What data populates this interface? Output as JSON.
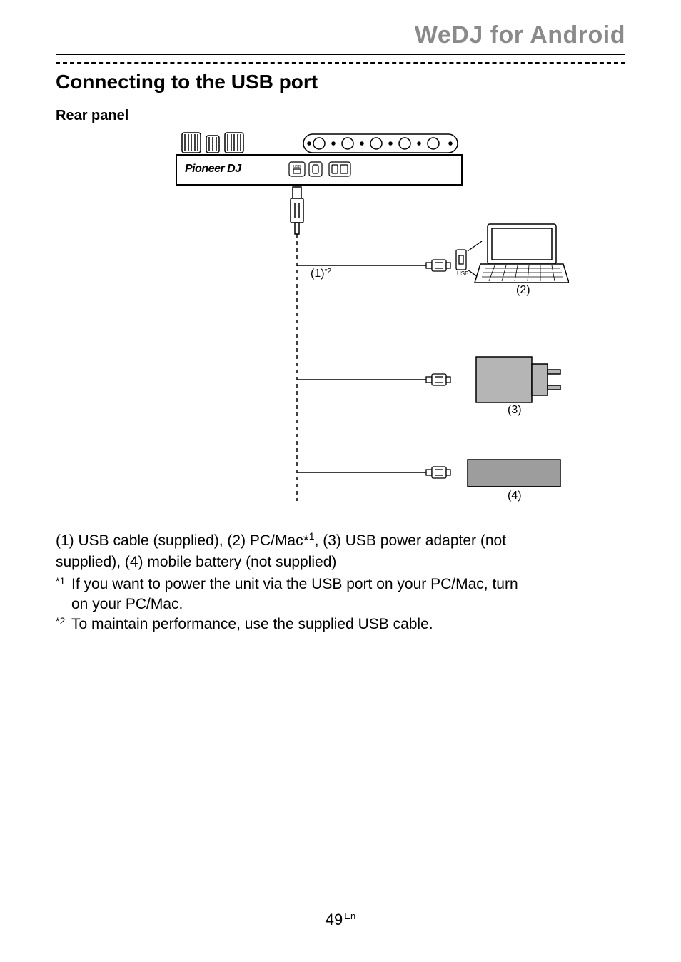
{
  "header": {
    "title": "WeDJ for Android"
  },
  "section": {
    "title": "Connecting to the USB port",
    "subheading": "Rear panel"
  },
  "diagram": {
    "brand": "Pioneer DJ",
    "usb_small_label": "USB",
    "callouts": {
      "c1": "(1)",
      "c1_sup": "*2",
      "c2": "(2)",
      "c3": "(3)",
      "c4": "(4)"
    }
  },
  "legend": {
    "line1_a": "(1) USB cable (supplied), (2) PC/Mac*",
    "line1_sup": "1",
    "line1_b": ", (3) USB power adapter (not",
    "line2": "supplied), (4) mobile battery (not supplied)"
  },
  "notes": {
    "n1_marker": "*1",
    "n1_text_a": "If you want to power the unit via the USB port on your PC/Mac, turn",
    "n1_text_b": "on your PC/Mac.",
    "n2_marker": "*2",
    "n2_text": "To maintain performance, use the supplied USB cable."
  },
  "footer": {
    "page": "49",
    "lang": "En"
  }
}
